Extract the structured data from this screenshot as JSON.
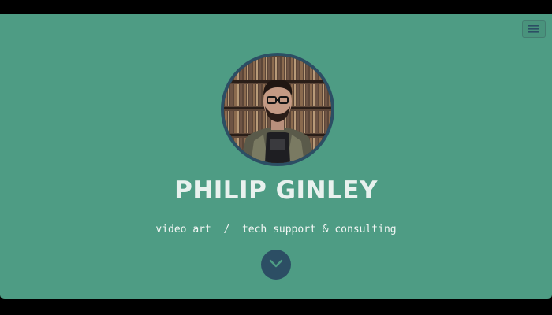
{
  "header": {
    "menu_icon": "hamburger-menu-icon"
  },
  "hero": {
    "name": "PHILIP GINLEY",
    "tagline": "video art  /  tech support & consulting",
    "scroll_icon": "chevron-down-icon"
  },
  "colors": {
    "background": "#4e9c84",
    "accent": "#2c4e64",
    "text": "#e8f1ee"
  }
}
